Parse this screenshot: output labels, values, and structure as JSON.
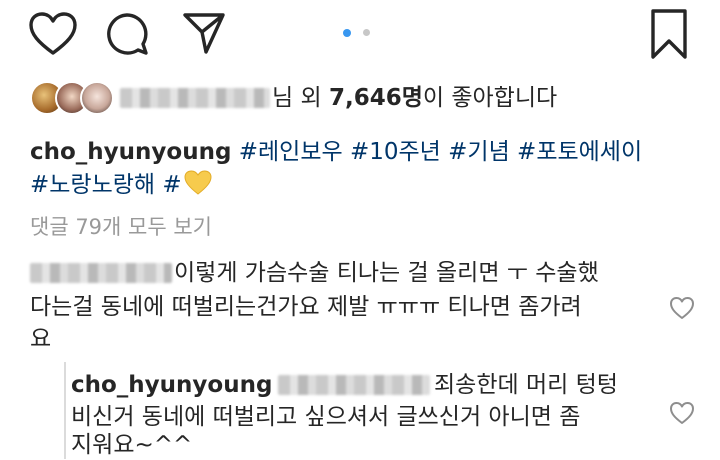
{
  "likes": {
    "suffix_before": "님 외 ",
    "count": "7,646명",
    "suffix_after": "이 좋아합니다"
  },
  "caption": {
    "username": "cho_hyunyoung",
    "tags_line1": "#레인보우 #10주년 #기념 #포토에세이",
    "tags_line2": "#노랑노랑해 #",
    "emoji": "💛"
  },
  "view_comments": "댓글 79개 모두 보기",
  "comments": [
    {
      "line1": "이렇게 가슴수술 티나는 걸 올리면 ㅜ 수술했",
      "line2": "다는걸 동네에 떠벌리는건가요 제발 ㅠㅠㅠ 티나면 좀가려",
      "line3": "요"
    }
  ],
  "reply": {
    "username": "cho_hyunyoung",
    "line1": "죄송한데 머리 텅텅",
    "line2": "비신거 동네에 떠벌리고 싶으셔서 글쓰신거 아니면 좀",
    "line3": "지워요~^^"
  },
  "carousel": {
    "total": 2,
    "active": 1
  },
  "colors": {
    "active_dot": "#3897f0",
    "inactive_dot": "#c7c7c7",
    "tag": "#003569",
    "meta": "#999999"
  },
  "icons": [
    "heart-icon",
    "comment-icon",
    "share-icon",
    "bookmark-icon",
    "heart-small-icon"
  ]
}
